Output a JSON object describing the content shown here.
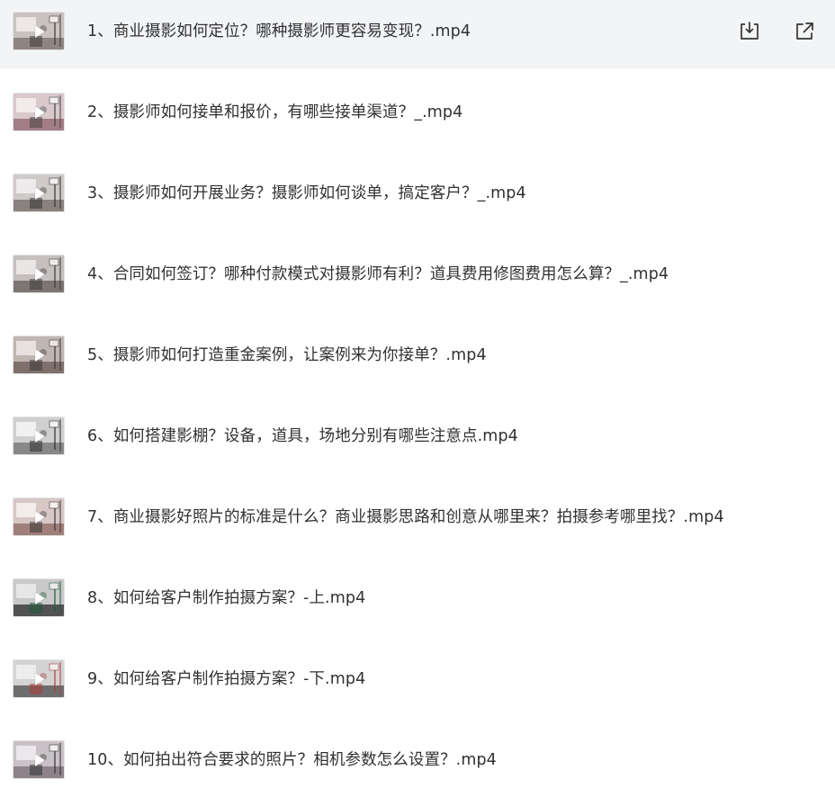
{
  "files": [
    {
      "name": "1、商业摄影如何定位？哪种摄影师更容易变现？.mp4",
      "icon": "video-thumbnail",
      "selected": true
    },
    {
      "name": "2、摄影师如何接单和报价，有哪些接单渠道？_.mp4",
      "icon": "video-thumbnail"
    },
    {
      "name": "3、摄影师如何开展业务？摄影师如何谈单，搞定客户？_.mp4",
      "icon": "video-thumbnail"
    },
    {
      "name": "4、合同如何签订？哪种付款模式对摄影师有利？道具费用修图费用怎么算？_.mp4",
      "icon": "video-thumbnail"
    },
    {
      "name": "5、摄影师如何打造重金案例，让案例来为你接单？.mp4",
      "icon": "video-thumbnail"
    },
    {
      "name": "6、如何搭建影棚？设备，道具，场地分别有哪些注意点.mp4",
      "icon": "video-thumbnail"
    },
    {
      "name": "7、商业摄影好照片的标准是什么？商业摄影思路和创意从哪里来？拍摄参考哪里找？.mp4",
      "icon": "video-thumbnail"
    },
    {
      "name": "8、如何给客户制作拍摄方案？-上.mp4",
      "icon": "video-thumbnail"
    },
    {
      "name": "9、如何给客户制作拍摄方案？-下.mp4",
      "icon": "video-thumbnail"
    },
    {
      "name": "10、如何拍出符合要求的照片？相机参数怎么设置？.mp4",
      "icon": "video-thumbnail"
    }
  ],
  "actions": {
    "download_icon": "download-icon",
    "share_icon": "external-link-icon"
  },
  "colors": {
    "selected_row_bg": "#f3f4f5",
    "text": "#303133",
    "icon": "#333333"
  }
}
